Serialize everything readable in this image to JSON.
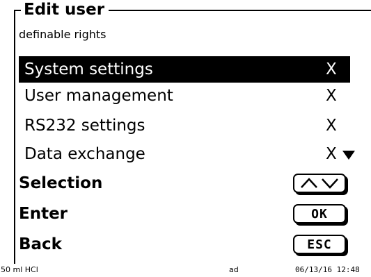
{
  "header": {
    "title": "Edit user",
    "subtitle": "definable rights"
  },
  "rights": [
    {
      "label": "System settings",
      "value": "X",
      "selected": true
    },
    {
      "label": "User management",
      "value": "X",
      "selected": false
    },
    {
      "label": "RS232 settings",
      "value": "X",
      "selected": false
    },
    {
      "label": "Data exchange",
      "value": "X",
      "selected": false
    }
  ],
  "commands": {
    "selection": {
      "label": "Selection",
      "key_icon": "up-down-arrows"
    },
    "enter": {
      "label": "Enter",
      "key": "OK"
    },
    "back": {
      "label": "Back",
      "key": "ESC"
    }
  },
  "status_bar": {
    "method": "50 ml HCl",
    "user": "ad",
    "datetime": "06/13/16 12:48"
  }
}
